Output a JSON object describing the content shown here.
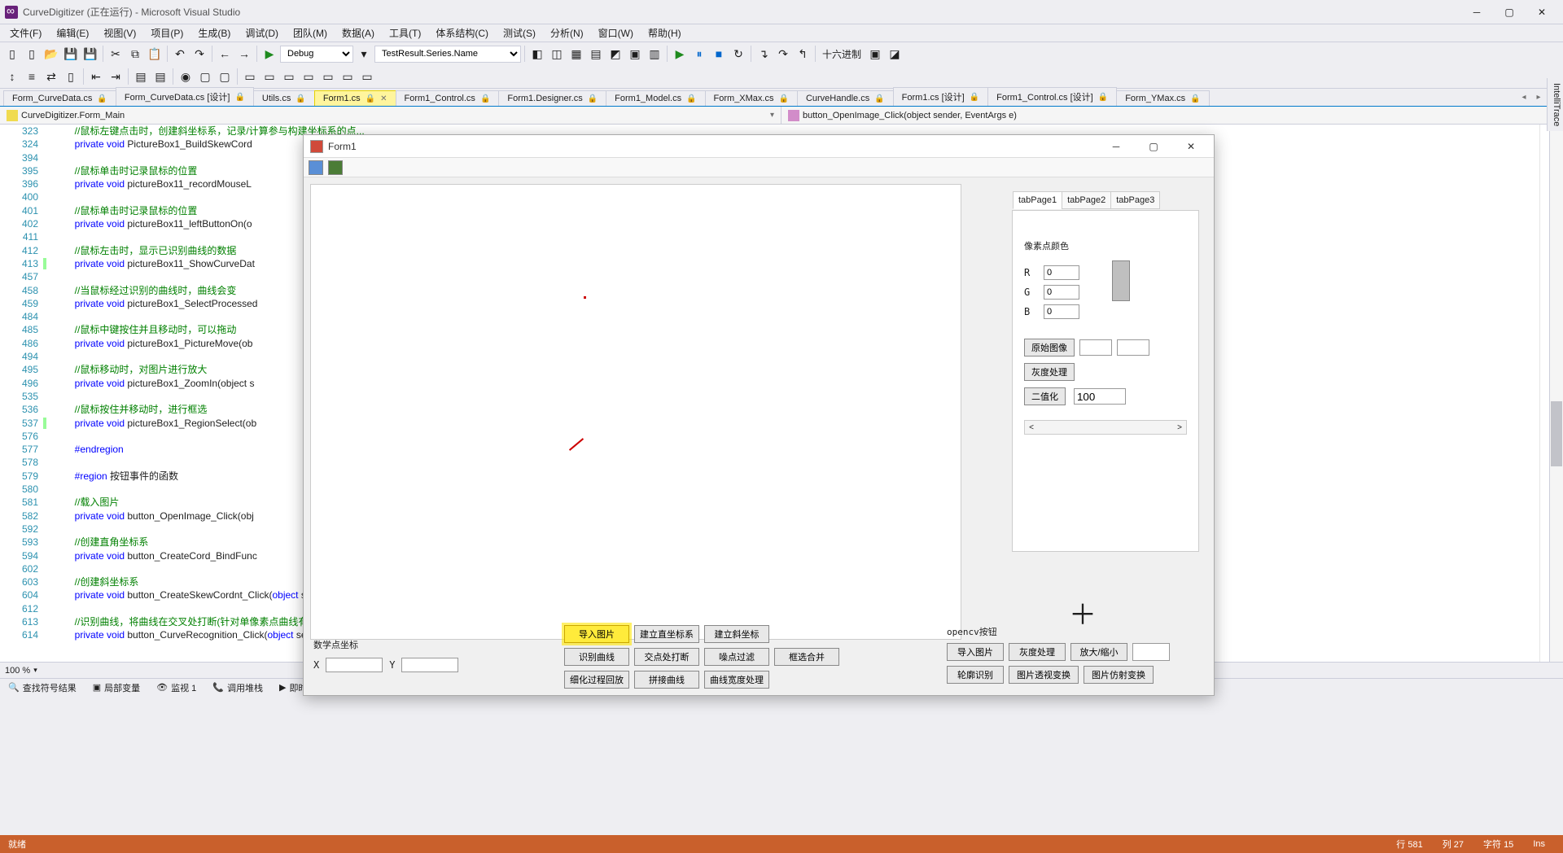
{
  "app": {
    "title": "CurveDigitizer (正在运行) - Microsoft Visual Studio"
  },
  "menu": [
    "文件(F)",
    "编辑(E)",
    "视图(V)",
    "项目(P)",
    "生成(B)",
    "调试(D)",
    "团队(M)",
    "数据(A)",
    "工具(T)",
    "体系结构(C)",
    "测试(S)",
    "分析(N)",
    "窗口(W)",
    "帮助(H)"
  ],
  "toolbar": {
    "config": "Debug",
    "scope": "TestResult.Series.Name",
    "radix": "十六进制"
  },
  "tabs": [
    {
      "label": "Form_CurveData.cs",
      "lock": true
    },
    {
      "label": "Form_CurveData.cs [设计]",
      "lock": true
    },
    {
      "label": "Utils.cs",
      "lock": true
    },
    {
      "label": "Form1.cs",
      "lock": true,
      "active": true,
      "close": true
    },
    {
      "label": "Form1_Control.cs",
      "lock": true
    },
    {
      "label": "Form1.Designer.cs",
      "lock": true
    },
    {
      "label": "Form1_Model.cs",
      "lock": true
    },
    {
      "label": "Form_XMax.cs",
      "lock": true
    },
    {
      "label": "CurveHandle.cs",
      "lock": true
    },
    {
      "label": "Form1.cs [设计]",
      "lock": true
    },
    {
      "label": "Form1_Control.cs [设计]",
      "lock": true
    },
    {
      "label": "Form_YMax.cs",
      "lock": true
    }
  ],
  "nav": {
    "left": "CurveDigitizer.Form_Main",
    "right": "button_OpenImage_Click(object sender, EventArgs e)"
  },
  "code_lines": [
    {
      "n": "323",
      "t": "//鼠标左键点击时，创建斜坐标系，记录/计算参与构建坐标系的点..."
    },
    {
      "n": "324",
      "t": "private void PictureBox1_BuildSkewCord"
    },
    {
      "n": "394",
      "t": ""
    },
    {
      "n": "395",
      "t": "//鼠标单击时记录鼠标的位置"
    },
    {
      "n": "396",
      "t": "private void pictureBox11_recordMouseL"
    },
    {
      "n": "400",
      "t": ""
    },
    {
      "n": "401",
      "t": "//鼠标单击时记录鼠标的位置"
    },
    {
      "n": "402",
      "t": "private void pictureBox11_leftButtonOn(o"
    },
    {
      "n": "411",
      "t": ""
    },
    {
      "n": "412",
      "t": "//鼠标左击时，显示已识别曲线的数据"
    },
    {
      "n": "413",
      "t": "private void pictureBox11_ShowCurveDat",
      "mark": true
    },
    {
      "n": "457",
      "t": ""
    },
    {
      "n": "458",
      "t": "//当鼠标经过识别的曲线时，曲线会变"
    },
    {
      "n": "459",
      "t": "private void pictureBox1_SelectProcessed"
    },
    {
      "n": "484",
      "t": ""
    },
    {
      "n": "485",
      "t": "//鼠标中键按住并且移动时，可以拖动"
    },
    {
      "n": "486",
      "t": "private void pictureBox1_PictureMove(ob"
    },
    {
      "n": "494",
      "t": ""
    },
    {
      "n": "495",
      "t": "//鼠标移动时，对图片进行放大"
    },
    {
      "n": "496",
      "t": "private void pictureBox1_ZoomIn(object s"
    },
    {
      "n": "535",
      "t": ""
    },
    {
      "n": "536",
      "t": "//鼠标按住并移动时，进行框选"
    },
    {
      "n": "537",
      "t": "private void pictureBox1_RegionSelect(ob",
      "mark": true
    },
    {
      "n": "576",
      "t": ""
    },
    {
      "n": "577",
      "t": "#endregion"
    },
    {
      "n": "578",
      "t": ""
    },
    {
      "n": "579",
      "t": "#region 按钮事件的函数"
    },
    {
      "n": "580",
      "t": ""
    },
    {
      "n": "581",
      "t": "//载入图片"
    },
    {
      "n": "582",
      "t": "private void button_OpenImage_Click(obj"
    },
    {
      "n": "592",
      "t": ""
    },
    {
      "n": "593",
      "t": "//创建直角坐标系"
    },
    {
      "n": "594",
      "t": "private void button_CreateCord_BindFunc"
    },
    {
      "n": "602",
      "t": ""
    },
    {
      "n": "603",
      "t": "//创建斜坐标系"
    },
    {
      "n": "604",
      "t": "private void button_CreateSkewCordnt_Click(object sender, EventArgs e)",
      "full": true
    },
    {
      "n": "612",
      "t": ""
    },
    {
      "n": "613",
      "t": "//识别曲线，将曲线在交叉处打断(针对单像素点曲线有效)"
    },
    {
      "n": "614",
      "t": "private void button_CurveRecognition_Click(object sender, EventArgs e)",
      "full": true
    }
  ],
  "zoom": "100 %",
  "bottom_tabs": [
    "查找符号结果",
    "局部变量",
    "监视 1",
    "调用堆栈",
    "即时窗口"
  ],
  "status": {
    "left": "就绪",
    "line_lbl": "行",
    "line": "581",
    "col_lbl": "列",
    "col": "27",
    "ch_lbl": "字符",
    "ch": "15",
    "ins": "Ins"
  },
  "side": "IntelliTrace",
  "form1": {
    "title": "Form1",
    "tabs": [
      "tabPage1",
      "tabPage2",
      "tabPage3"
    ],
    "pixel_color_label": "像素点颜色",
    "r": "R",
    "g": "G",
    "b": "B",
    "r_val": "0",
    "g_val": "0",
    "b_val": "0",
    "orig": "原始图像",
    "gray": "灰度处理",
    "bin": "二值化",
    "bin_val": "100",
    "coord_label": "数学点坐标",
    "x": "X",
    "y": "Y",
    "btns": {
      "r1": [
        "导入图片",
        "建立直坐标系",
        "建立斜坐标"
      ],
      "r2": [
        "识别曲线",
        "交点处打断",
        "噪点过滤",
        "框选合并"
      ],
      "r3": [
        "细化过程回放",
        "拼接曲线",
        "曲线宽度处理"
      ]
    },
    "cv_label": "opencv按钮",
    "cv": {
      "r1": [
        "导入图片",
        "灰度处理",
        "放大/缩小"
      ],
      "r2": [
        "轮廓识别",
        "图片透视变换",
        "图片仿射变换"
      ]
    }
  }
}
